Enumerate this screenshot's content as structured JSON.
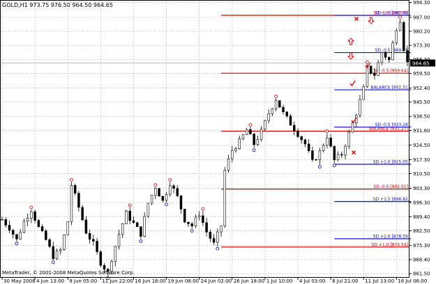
{
  "window": {
    "title": "GOLD,H1  973.75 976.50 964.50 964.65",
    "copyright": "MetaTrader, © 2001-2008 MetaQuotes Software Corp."
  },
  "colors": {
    "background": "#ffffff",
    "grid": "#c0c0c0",
    "candle": "#000000",
    "red_level": "#dd0000",
    "blue_level": "#1010cc",
    "fractal_up": "#cc2222",
    "fractal_down": "#2020cc",
    "current_price_bg": "#000000",
    "current_price_fg": "#ffffff"
  },
  "icons": {
    "check_mark": "check-icon",
    "cross_mark": "cross-icon",
    "arrow_up": "arrow-up-icon",
    "arrow_down": "arrow-down-icon"
  },
  "current_price": "964.65",
  "chart_data": {
    "type": "candlestick",
    "symbol": "GOLD",
    "timeframe": "H1",
    "ylim": [
      859.5,
      995.5
    ],
    "y_ticks": [
      "994.30",
      "987.00",
      "980.20",
      "973.30",
      "966.30",
      "959.50",
      "952.40",
      "945.50",
      "938.50",
      "931.60",
      "924.50",
      "917.30",
      "910.50",
      "903.30",
      "896.30",
      "889.40",
      "882.50",
      "875.30",
      "868.40",
      "861.50"
    ],
    "y_tick_values": [
      994.3,
      987.0,
      980.2,
      973.3,
      966.3,
      959.5,
      952.4,
      945.5,
      938.5,
      931.6,
      924.5,
      917.3,
      910.5,
      903.3,
      896.3,
      889.4,
      882.5,
      875.3,
      868.4,
      861.5
    ],
    "x_ticks": [
      "30 May 2008",
      "4 Jun 13:00",
      "9 Jun 05:00",
      "11 Jun 22:00",
      "16 Jun 16:00",
      "19 Jun 08:00",
      "24 Jun 02:00",
      "26 Jun 18:00",
      "1 Jul 10:00",
      "4 Jul 03:00",
      "8 Jul 21:00",
      "11 Jul 13:00",
      "16 Jul 06:00"
    ],
    "x_tick_index": [
      0,
      9,
      18,
      27,
      36,
      45,
      54,
      63,
      72,
      81,
      90,
      99,
      108
    ],
    "bars_visible": 112,
    "close_path": [
      [
        0,
        888
      ],
      [
        2,
        884
      ],
      [
        4,
        878
      ],
      [
        6,
        887
      ],
      [
        8,
        893
      ],
      [
        10,
        884
      ],
      [
        12,
        878
      ],
      [
        14,
        870
      ],
      [
        16,
        873
      ],
      [
        18,
        887
      ],
      [
        19,
        905
      ],
      [
        21,
        894
      ],
      [
        23,
        882
      ],
      [
        25,
        876
      ],
      [
        27,
        867
      ],
      [
        29,
        862
      ],
      [
        30,
        869
      ],
      [
        32,
        881
      ],
      [
        34,
        891
      ],
      [
        36,
        886
      ],
      [
        38,
        881
      ],
      [
        40,
        896
      ],
      [
        42,
        904
      ],
      [
        44,
        897
      ],
      [
        46,
        906
      ],
      [
        48,
        899
      ],
      [
        50,
        888
      ],
      [
        52,
        885
      ],
      [
        54,
        891
      ],
      [
        56,
        882
      ],
      [
        58,
        876
      ],
      [
        60,
        885
      ],
      [
        61,
        912
      ],
      [
        63,
        922
      ],
      [
        65,
        926
      ],
      [
        67,
        932
      ],
      [
        69,
        925
      ],
      [
        71,
        931
      ],
      [
        73,
        940
      ],
      [
        75,
        947
      ],
      [
        77,
        940
      ],
      [
        79,
        935
      ],
      [
        81,
        930
      ],
      [
        83,
        925
      ],
      [
        85,
        916
      ],
      [
        87,
        921
      ],
      [
        89,
        929
      ],
      [
        91,
        917
      ],
      [
        93,
        920
      ],
      [
        95,
        930
      ],
      [
        97,
        940
      ],
      [
        99,
        952
      ],
      [
        100,
        962
      ],
      [
        102,
        959
      ],
      [
        104,
        970
      ],
      [
        106,
        966
      ],
      [
        108,
        982
      ],
      [
        109,
        986
      ],
      [
        110,
        972
      ],
      [
        111,
        964.65
      ]
    ],
    "level_lines": [
      {
        "group": "red",
        "label": "SD -1.0 [988.00]",
        "value": 988.0
      },
      {
        "group": "red",
        "label": "SD -0.5 [959.64]",
        "value": 959.64
      },
      {
        "group": "red",
        "label": "BALANCE [931.27]",
        "value": 931.27
      },
      {
        "group": "red",
        "label": "SD -0.5 [902.91]",
        "value": 902.91
      },
      {
        "group": "red",
        "label": "SD +1.0 [874.54]",
        "value": 874.54
      },
      {
        "group": "blue",
        "label": "SD -1.0 [987.98]",
        "value": 987.98
      },
      {
        "group": "blue",
        "label": "SD -0.5 [969.75]",
        "value": 969.75
      },
      {
        "group": "blue",
        "label": "BALANCE [951.51]",
        "value": 951.51
      },
      {
        "group": "blue",
        "label": "SD -0.5 [933.28]",
        "value": 933.28
      },
      {
        "group": "blue",
        "label": "SD +1.0 [915.05]",
        "value": 915.05
      },
      {
        "group": "blue",
        "label": "SD +1.5 [896.82]",
        "value": 896.82
      },
      {
        "group": "blue",
        "label": "SD +2.0 [878.59]",
        "value": 878.59
      }
    ]
  }
}
